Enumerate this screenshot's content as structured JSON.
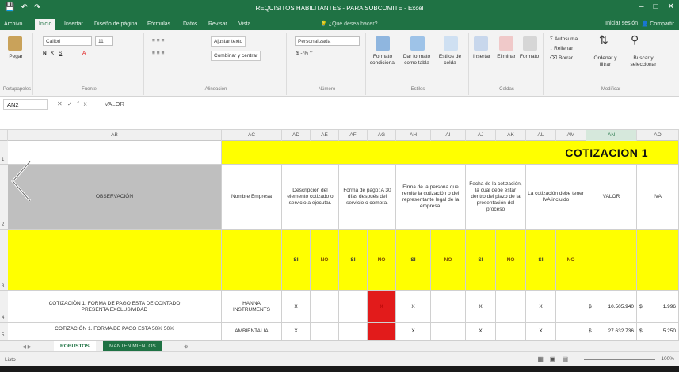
{
  "window": {
    "title": "REQUISITOS HABILITANTES - PARA SUBCOMITE - Excel",
    "qat_icons": [
      "save-icon",
      "undo-icon",
      "redo-icon"
    ],
    "controls": [
      "minimize-icon",
      "maximize-icon",
      "close-icon"
    ]
  },
  "tabs": [
    {
      "label": "Archivo"
    },
    {
      "label": "Inicio"
    },
    {
      "label": "Insertar"
    },
    {
      "label": "Diseño de página"
    },
    {
      "label": "Fórmulas"
    },
    {
      "label": "Datos"
    },
    {
      "label": "Revisar"
    },
    {
      "label": "Vista"
    }
  ],
  "tell_me": "¿Qué desea hacer?",
  "signin": "Iniciar sesión",
  "share": "Compartir",
  "ribbon": {
    "clipboard": {
      "paste": "Pegar",
      "label": "Portapapeles"
    },
    "font": {
      "name": "Calibri",
      "size": "11",
      "label": "Fuente"
    },
    "alignment": {
      "wrap": "Ajustar texto",
      "merge": "Combinar y centrar",
      "label": "Alineación"
    },
    "number": {
      "format": "Personalizada",
      "label": "Número"
    },
    "styles": {
      "cond": "Formato condicional",
      "table": "Dar formato como tabla",
      "cell": "Estilos de celda",
      "label": "Estilos"
    },
    "cells": {
      "insert": "Insertar",
      "delete": "Eliminar",
      "format": "Formato",
      "label": "Celdas"
    },
    "editing": {
      "autosum": "Autosuma",
      "fill": "Rellenar",
      "clear": "Borrar",
      "sort": "Ordenar y filtrar",
      "find": "Buscar y seleccionar",
      "label": "Modificar"
    }
  },
  "formula_bar": {
    "name_box": "AN2",
    "fx": "fx",
    "value": "VALOR"
  },
  "columns": [
    {
      "label": "AB"
    },
    {
      "label": "AC"
    },
    {
      "label": "AD"
    },
    {
      "label": "AE"
    },
    {
      "label": "AF"
    },
    {
      "label": "AG"
    },
    {
      "label": "AH"
    },
    {
      "label": "AI"
    },
    {
      "label": "AJ"
    },
    {
      "label": "AK"
    },
    {
      "label": "AL"
    },
    {
      "label": "AM"
    },
    {
      "label": "AN"
    },
    {
      "label": "AO"
    }
  ],
  "rows": [
    "1",
    "2",
    "3",
    "4",
    "5"
  ],
  "sheet": {
    "cotizacion_title": "COTIZACION 1",
    "headers": {
      "observacion": "OBSERVACIÓN",
      "empresa": "Nombre Empresa",
      "descripcion": "Descripción del elemento cotizado o servicio a ejecutar.",
      "forma_pago": "Forma de pago: A 30 días después del servicio o compra.",
      "firma": "Firma de la persona que remite la cotización o del representante legal de la empresa.",
      "fecha": "Fecha de la cotización, la cual debe estar dentro del plazo de la presentación del proceso",
      "iva": "La cotización debe tener IVA incluido",
      "valor": "VALOR",
      "iva_col": "IVA"
    },
    "si": "SI",
    "no": "NO",
    "data_rows": [
      {
        "observacion": "COTIZACIÓN 1. FORMA DE PAGO ESTA DE CONTADO PRESENTA EXCLUSIVIDAD",
        "empresa": "HANNA INSTRUMENTS",
        "marks": [
          "X",
          "",
          "",
          "X",
          "X",
          "",
          "X",
          "",
          "X",
          ""
        ],
        "valor": "10.505.940",
        "iva": "1.996",
        "currency": "$"
      },
      {
        "observacion": "COTIZACIÓN 1. FORMA DE PAGO ESTA 50% 50%",
        "empresa": "AMBIENTALIA",
        "marks": [
          "X",
          "",
          "",
          "",
          "X",
          "",
          "X",
          "",
          "X",
          ""
        ],
        "valor": "27.632.736",
        "iva": "5.250",
        "currency": "$"
      }
    ]
  },
  "sheet_tabs": [
    {
      "label": "ROBUSTOS",
      "active": true
    },
    {
      "label": "MANTENIMIENTOS",
      "active": false
    }
  ],
  "status": {
    "ready": "Listo",
    "zoom": "100%"
  },
  "colors": {
    "excel_green": "#1f7244",
    "highlight_yellow": "#ffff00",
    "alert_red": "#e21b1b",
    "header_gray": "#bfbfbf"
  }
}
